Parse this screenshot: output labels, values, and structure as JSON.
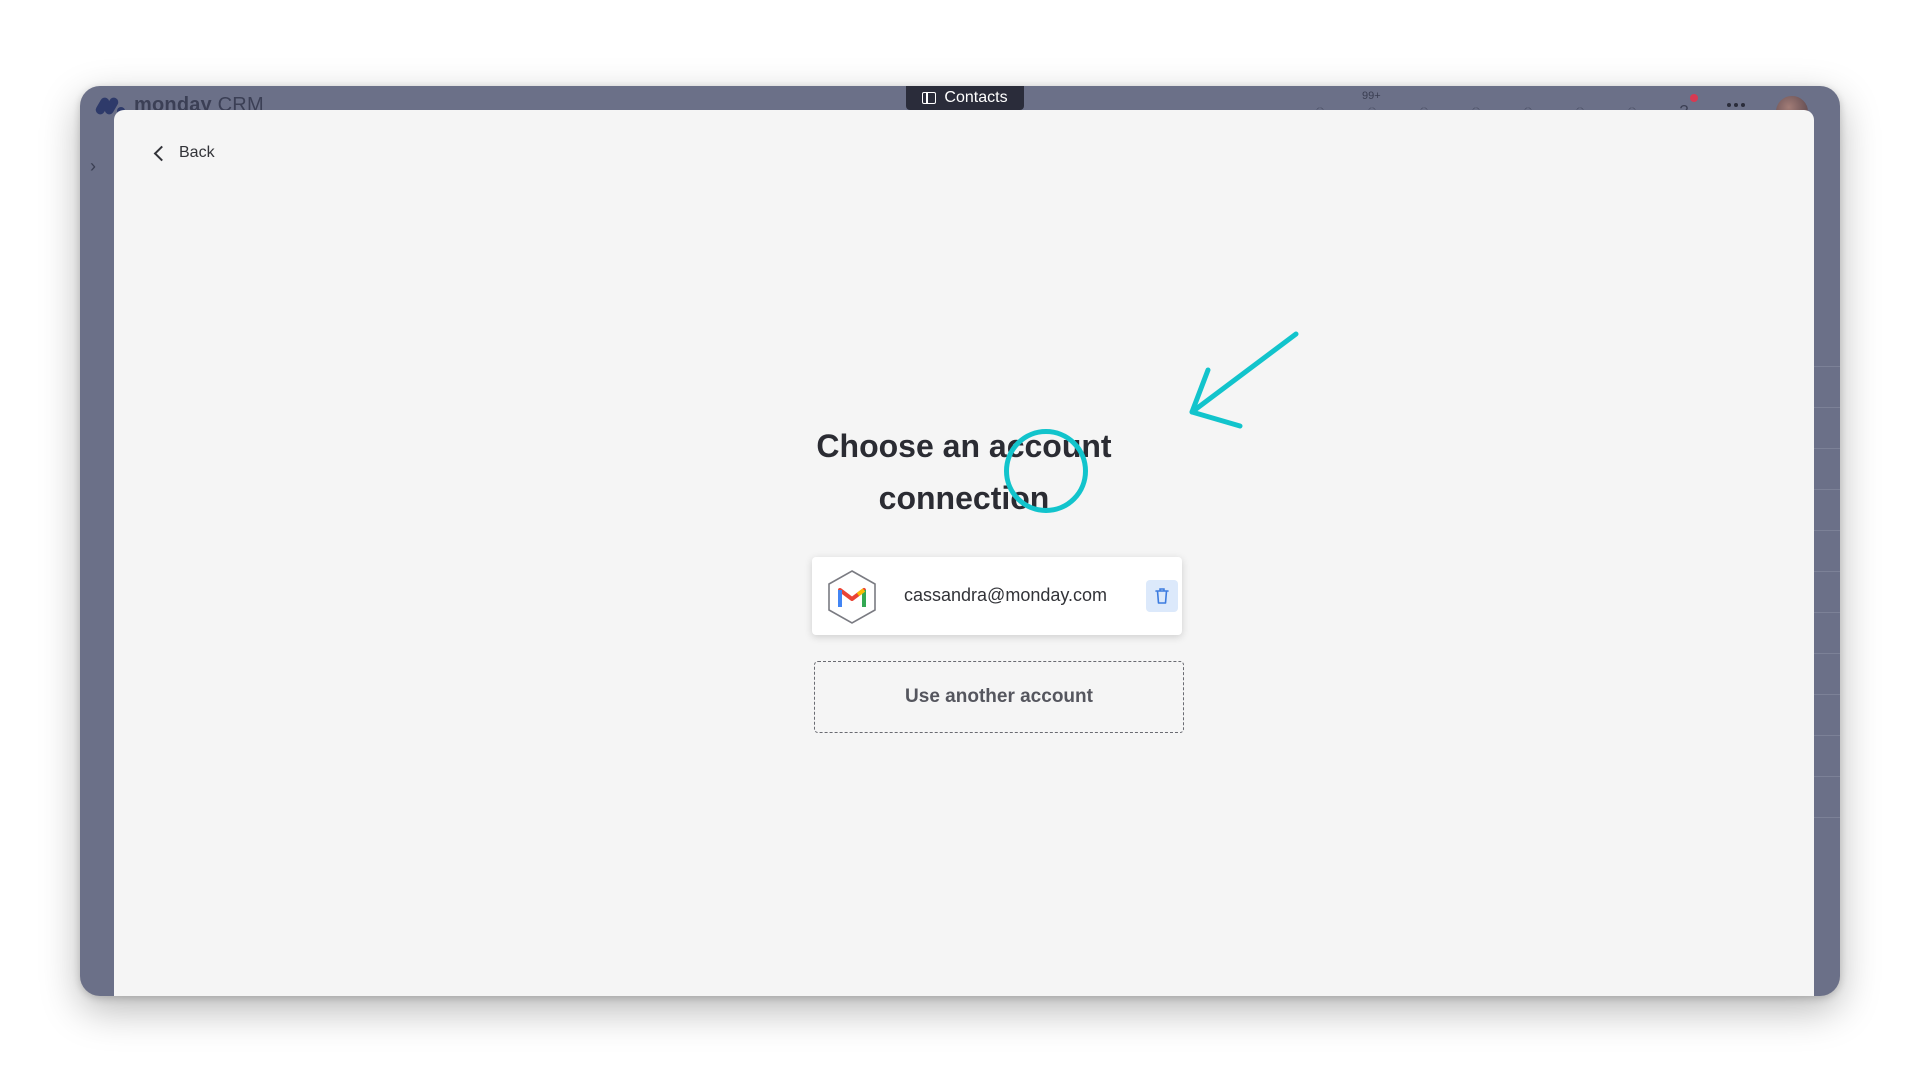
{
  "app": {
    "brand_name": "monday",
    "brand_suffix": "CRM",
    "tab_label": "Contacts",
    "notification_count": "99+"
  },
  "panel": {
    "back_label": "Back",
    "heading_line1": "Choose an account",
    "heading_line2": "connection",
    "account": {
      "email": "cassandra@monday.com",
      "provider_icon": "gmail-icon",
      "delete_icon": "trash-icon"
    },
    "other_account_label": "Use another account"
  },
  "annotation": {
    "color": "#12c4cc"
  },
  "colors": {
    "window_frame": "#6b7088",
    "panel_bg": "#f5f5f5",
    "delete_bg": "#dce9fb",
    "delete_icon": "#3d7ce0"
  }
}
